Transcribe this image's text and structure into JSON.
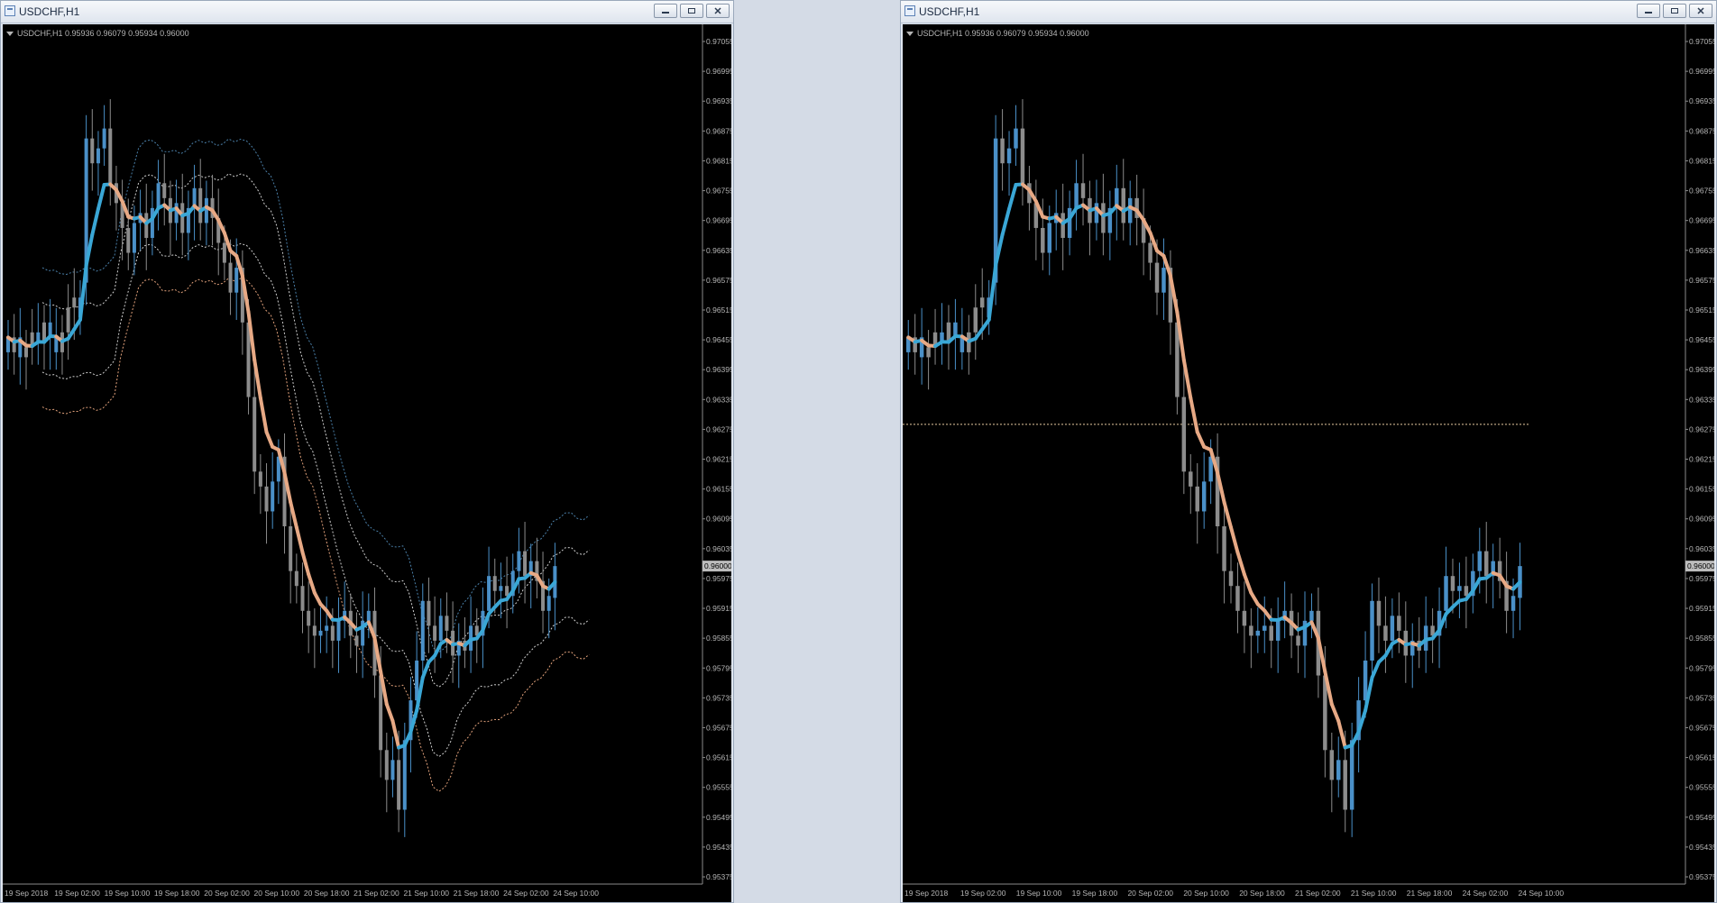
{
  "windows": [
    {
      "title": "USDCHF,H1",
      "chart_label": "USDCHF,H1  0.95936 0.96079 0.95934 0.96000",
      "show_envelopes": true,
      "show_hline": false
    },
    {
      "title": "USDCHF,H1",
      "chart_label": "USDCHF,H1  0.95936 0.96079 0.95934 0.96000",
      "show_envelopes": false,
      "show_hline": true
    }
  ],
  "window_buttons": {
    "minimize": "minimize-icon",
    "restore": "restore-icon",
    "close": "close-icon"
  },
  "colors": {
    "background": "#000000",
    "bull_candle": "#4a90c8",
    "bear_candle": "#8c8c8c",
    "ma_up": "#3aa7d6",
    "ma_down": "#e7a985",
    "axis_text": "#b5b5b5",
    "price_tag_bg": "#bdbdbd"
  },
  "chart_data": {
    "type": "candlestick",
    "symbol": "USDCHF",
    "timeframe": "H1",
    "ohlc_current": {
      "open": 0.95936,
      "high": 0.96079,
      "low": 0.95934,
      "close": 0.96
    },
    "current_price_label": "0.96000",
    "y_ticks": [
      "0.97055",
      "0.96995",
      "0.96935",
      "0.96875",
      "0.96815",
      "0.96755",
      "0.96695",
      "0.96635",
      "0.96575",
      "0.96515",
      "0.96455",
      "0.96395",
      "0.96335",
      "0.96275",
      "0.96215",
      "0.96155",
      "0.96095",
      "0.96035",
      "0.95975",
      "0.95915",
      "0.95855",
      "0.95795",
      "0.95735",
      "0.95675",
      "0.95615",
      "0.95555",
      "0.95495",
      "0.95435",
      "0.95375"
    ],
    "ylim": [
      0.95375,
      0.97075
    ],
    "x_ticks": [
      "19 Sep 2018",
      "19 Sep 02:00",
      "19 Sep 10:00",
      "19 Sep 18:00",
      "20 Sep 02:00",
      "20 Sep 10:00",
      "20 Sep 18:00",
      "21 Sep 02:00",
      "21 Sep 10:00",
      "21 Sep 18:00",
      "24 Sep 02:00",
      "24 Sep 10:00"
    ],
    "horizontal_line": 0.96285,
    "closes": [
      0.9646,
      0.9643,
      0.9646,
      0.9642,
      0.9644,
      0.9647,
      0.9645,
      0.9649,
      0.9646,
      0.9643,
      0.9647,
      0.9652,
      0.9654,
      0.9686,
      0.9681,
      0.9684,
      0.9688,
      0.9677,
      0.9673,
      0.9668,
      0.9663,
      0.9669,
      0.9671,
      0.9666,
      0.9672,
      0.9677,
      0.9674,
      0.9669,
      0.9673,
      0.9667,
      0.9672,
      0.9676,
      0.9669,
      0.9674,
      0.967,
      0.9665,
      0.9661,
      0.9655,
      0.966,
      0.9649,
      0.9634,
      0.9619,
      0.9616,
      0.9611,
      0.9617,
      0.9622,
      0.9608,
      0.9599,
      0.9596,
      0.9591,
      0.9588,
      0.9586,
      0.9587,
      0.9588,
      0.9585,
      0.9589,
      0.9591,
      0.9586,
      0.9584,
      0.9589,
      0.9591,
      0.9578,
      0.9563,
      0.9557,
      0.9561,
      0.9551,
      0.9565,
      0.9573,
      0.9581,
      0.9593,
      0.9588,
      0.9585,
      0.959,
      0.9587,
      0.9582,
      0.9585,
      0.9583,
      0.9588,
      0.9586,
      0.9591,
      0.9598,
      0.9595,
      0.9596,
      0.9594,
      0.9599,
      0.9603,
      0.9598,
      0.9601,
      0.9597,
      0.9591,
      0.9594,
      0.96
    ],
    "opens": [
      0.9643,
      0.9646,
      0.9642,
      0.9644,
      0.9647,
      0.9645,
      0.9649,
      0.9646,
      0.9643,
      0.9647,
      0.9652,
      0.9654,
      0.965,
      0.9657,
      0.9686,
      0.9681,
      0.9684,
      0.9688,
      0.9677,
      0.9673,
      0.9668,
      0.9663,
      0.9669,
      0.9671,
      0.9666,
      0.9672,
      0.9677,
      0.9674,
      0.9669,
      0.9673,
      0.9667,
      0.9672,
      0.9676,
      0.9669,
      0.9674,
      0.967,
      0.9665,
      0.9661,
      0.9655,
      0.966,
      0.9649,
      0.9634,
      0.9619,
      0.9616,
      0.9611,
      0.9617,
      0.9622,
      0.9608,
      0.9599,
      0.9596,
      0.9591,
      0.9588,
      0.9586,
      0.9587,
      0.9588,
      0.9585,
      0.9589,
      0.9591,
      0.9586,
      0.9584,
      0.9589,
      0.9591,
      0.9578,
      0.9563,
      0.9557,
      0.9561,
      0.9551,
      0.9565,
      0.9573,
      0.9581,
      0.9593,
      0.9588,
      0.9585,
      0.959,
      0.9587,
      0.9582,
      0.9585,
      0.9583,
      0.9588,
      0.9586,
      0.9591,
      0.9598,
      0.9595,
      0.9596,
      0.9594,
      0.9599,
      0.9603,
      0.9598,
      0.9601,
      0.9597,
      0.9591,
      0.95936
    ]
  }
}
